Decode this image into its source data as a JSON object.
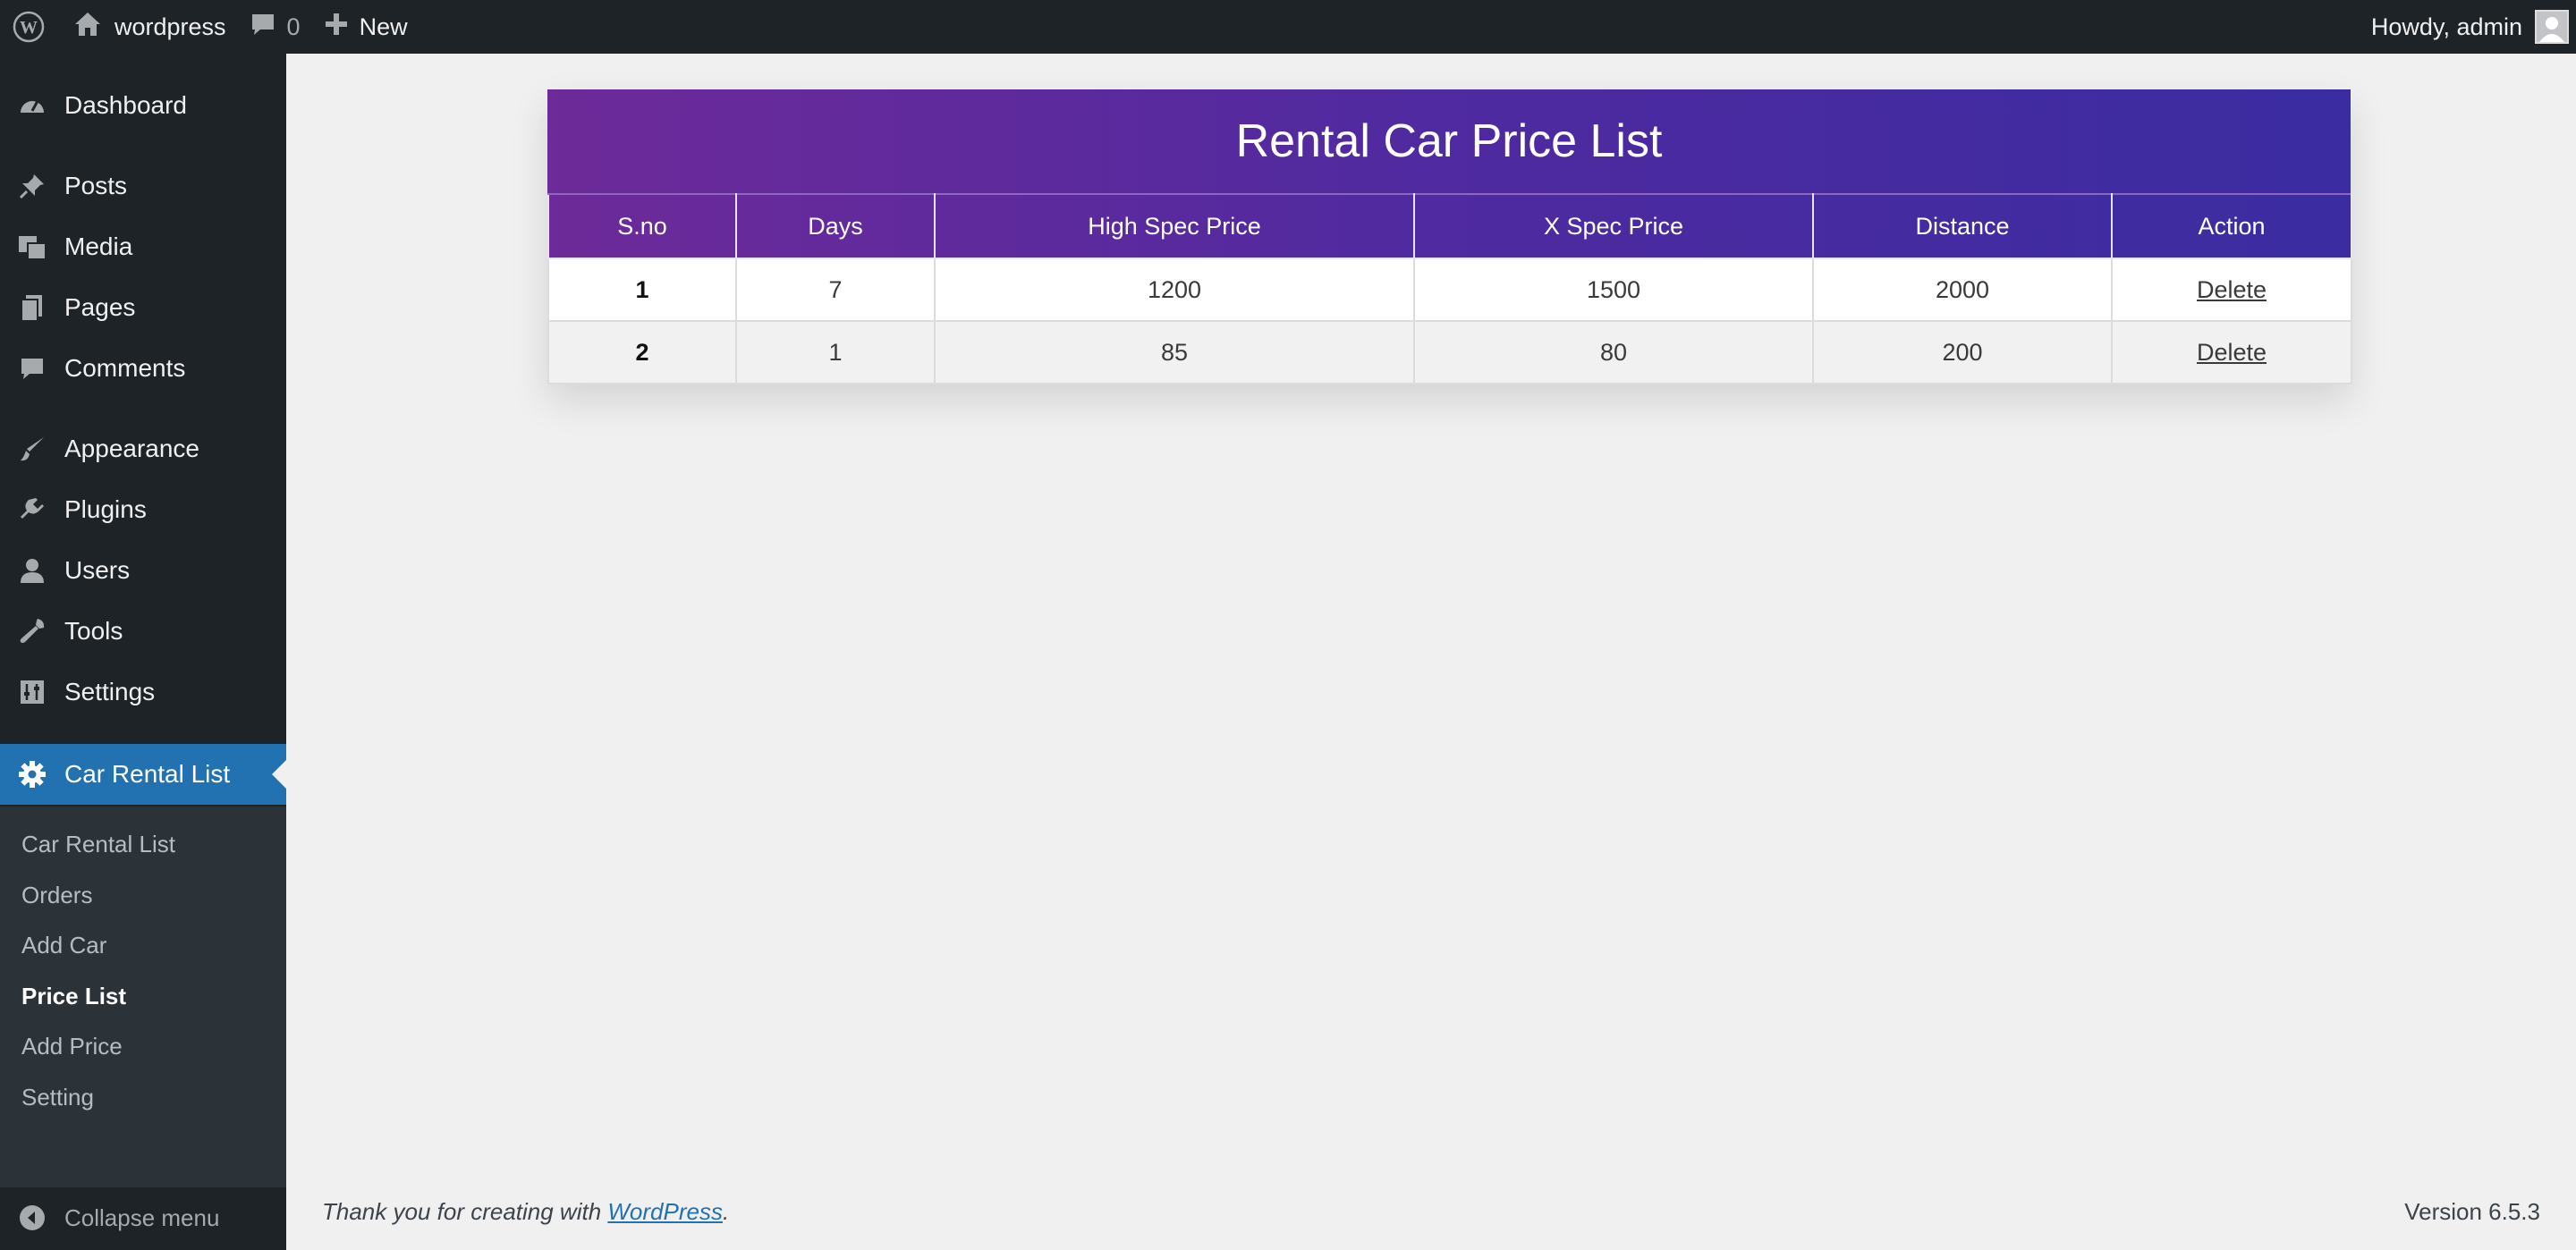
{
  "adminbar": {
    "site_name": "wordpress",
    "comments_count": "0",
    "new_label": "New",
    "greeting": "Howdy, admin"
  },
  "sidebar": {
    "items": [
      {
        "label": "Dashboard",
        "icon": "dashboard-icon"
      },
      {
        "label": "Posts",
        "icon": "pin-icon"
      },
      {
        "label": "Media",
        "icon": "media-icon"
      },
      {
        "label": "Pages",
        "icon": "pages-icon"
      },
      {
        "label": "Comments",
        "icon": "comment-icon"
      },
      {
        "label": "Appearance",
        "icon": "brush-icon"
      },
      {
        "label": "Plugins",
        "icon": "plug-icon"
      },
      {
        "label": "Users",
        "icon": "user-icon"
      },
      {
        "label": "Tools",
        "icon": "wrench-icon"
      },
      {
        "label": "Settings",
        "icon": "sliders-icon"
      },
      {
        "label": "Car Rental List",
        "icon": "gear-icon"
      }
    ],
    "submenu": [
      {
        "label": "Car Rental List"
      },
      {
        "label": "Orders"
      },
      {
        "label": "Add Car"
      },
      {
        "label": "Price List"
      },
      {
        "label": "Add Price"
      },
      {
        "label": "Setting"
      }
    ],
    "collapse_label": "Collapse menu",
    "accent_color": "#2271b1"
  },
  "main": {
    "title": "Rental Car Price List",
    "columns": [
      "S.no",
      "Days",
      "High Spec Price",
      "X Spec Price",
      "Distance",
      "Action"
    ],
    "rows": [
      {
        "sno": "1",
        "days": "7",
        "high": "1200",
        "x": "1500",
        "distance": "2000",
        "action": "Delete"
      },
      {
        "sno": "2",
        "days": "1",
        "high": "85",
        "x": "80",
        "distance": "200",
        "action": "Delete"
      }
    ],
    "gradient_start": "#6d2a99",
    "gradient_end": "#3b2ca1"
  },
  "footer": {
    "thanks_prefix": "Thank you for creating with ",
    "thanks_link": "WordPress",
    "thanks_suffix": ".",
    "version": "Version 6.5.3"
  }
}
